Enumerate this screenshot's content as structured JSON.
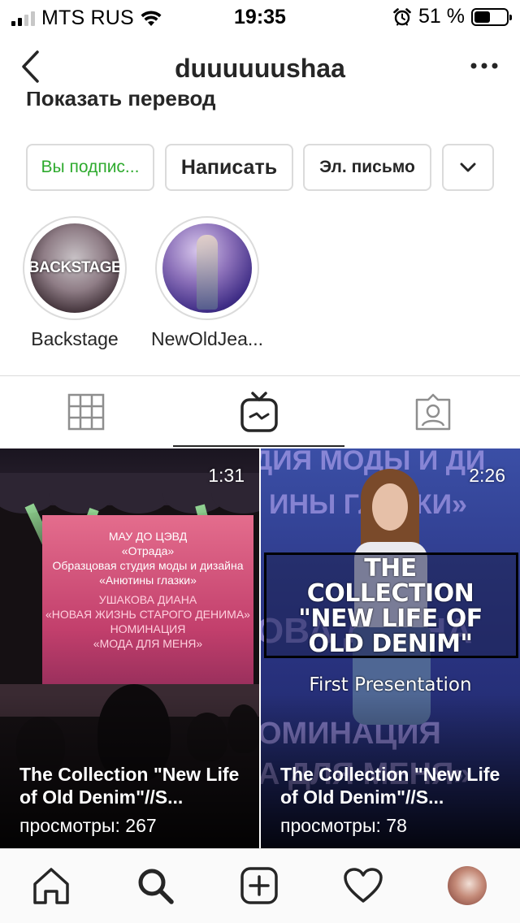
{
  "status_bar": {
    "carrier": "MTS RUS",
    "time": "19:35",
    "battery_percent": "51 %",
    "battery_level": 0.51,
    "signal_bars": 2
  },
  "header": {
    "username": "duuuuuushaa",
    "back_icon": "chevron-left-icon",
    "more_icon": "more-horizontal-icon"
  },
  "bio": {
    "translate_link": "Показать перевод"
  },
  "actions": {
    "following_label": "Вы подпис...",
    "message_label": "Написать",
    "email_label": "Эл. письмо",
    "more_icon": "chevron-down-icon"
  },
  "highlights": [
    {
      "label": "Backstage",
      "cover_text": "BACKSTAGE"
    },
    {
      "label": "NewOldJea..."
    }
  ],
  "tabs": [
    {
      "name": "grid",
      "icon": "grid-icon",
      "active": false
    },
    {
      "name": "igtv",
      "icon": "igtv-icon",
      "active": true
    },
    {
      "name": "tagged",
      "icon": "tagged-icon",
      "active": false
    }
  ],
  "videos": [
    {
      "duration": "1:31",
      "title": "The Collection \"New Life of Old Denim\"//S...",
      "views": "просмотры: 267",
      "screen_lines": [
        "МАУ ДО ЦЭВД",
        "«Отрада»",
        "Образцовая студия моды и дизайна",
        "«Анютины глазки»",
        "УШАКОВА ДИАНА",
        "«НОВАЯ ЖИЗНЬ СТАРОГО ДЕНИМА»",
        "НОМИНАЦИЯ",
        "«МОДА ДЛЯ МЕНЯ»"
      ]
    },
    {
      "duration": "2:26",
      "title": "The Collection \"New Life of Old Denim\"//S...",
      "views": "просмотры: 78",
      "overlay_lines": [
        "THE",
        "COLLECTION",
        "\"NEW LIFE OF",
        "OLD DENIM\""
      ],
      "overlay_subtitle": "First Presentation"
    }
  ],
  "bottom_nav": [
    {
      "name": "home",
      "icon": "home-icon"
    },
    {
      "name": "search",
      "icon": "search-icon"
    },
    {
      "name": "new-post",
      "icon": "plus-square-icon"
    },
    {
      "name": "activity",
      "icon": "heart-icon"
    },
    {
      "name": "profile",
      "icon": "avatar"
    }
  ],
  "colors": {
    "following_text": "#2eaa2e",
    "border": "#dbdbdb",
    "text": "#262626"
  }
}
